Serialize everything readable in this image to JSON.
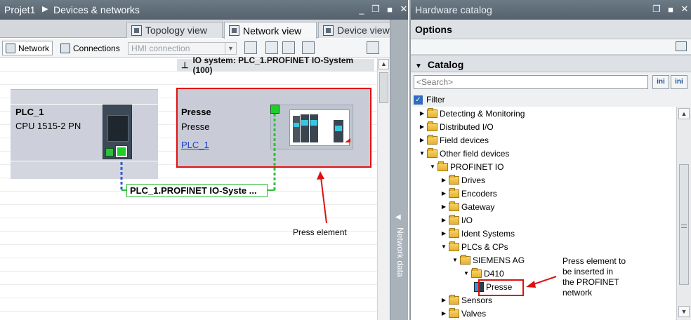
{
  "left_panel": {
    "breadcrumb": {
      "project": "Projet1",
      "separator": "▶",
      "page": "Devices & networks"
    },
    "window_buttons": [
      "_",
      "❐",
      "■",
      "✕"
    ],
    "tabs": [
      {
        "label": "Topology view",
        "active": false
      },
      {
        "label": "Network view",
        "active": true
      },
      {
        "label": "Device view",
        "active": false
      }
    ],
    "toolbar": {
      "network_label": "Network",
      "connections_label": "Connections",
      "connection_type": "HMI connection"
    },
    "io_system_label": "IO system: PLC_1.PROFINET IO-System (100)",
    "pin_icon": "⊥",
    "devices": {
      "plc": {
        "name": "PLC_1",
        "type": "CPU 1515-2 PN"
      },
      "presse": {
        "name": "Presse",
        "type": "Presse",
        "controller_link": "PLC_1"
      }
    },
    "network_label": "PLC_1.PROFINET  IO-Syste ...",
    "annotation": "Press element",
    "side_panel_label": "Network data",
    "side_panel_arrow": "◀"
  },
  "right_panel": {
    "title": "Hardware catalog",
    "options_label": "Options",
    "catalog_label": "Catalog",
    "search_placeholder": "<Search>",
    "search_buttons": [
      "ini",
      "ini"
    ],
    "filter_label": "Filter",
    "filter_checked": true,
    "tree": [
      {
        "label": "Detecting & Monitoring",
        "level": 0,
        "expanded": false
      },
      {
        "label": "Distributed I/O",
        "level": 0,
        "expanded": false
      },
      {
        "label": "Field devices",
        "level": 0,
        "expanded": false
      },
      {
        "label": "Other field devices",
        "level": 0,
        "expanded": true
      },
      {
        "label": "PROFINET IO",
        "level": 1,
        "expanded": true
      },
      {
        "label": "Drives",
        "level": 2,
        "expanded": false
      },
      {
        "label": "Encoders",
        "level": 2,
        "expanded": false
      },
      {
        "label": "Gateway",
        "level": 2,
        "expanded": false
      },
      {
        "label": "I/O",
        "level": 2,
        "expanded": false
      },
      {
        "label": "Ident Systems",
        "level": 2,
        "expanded": false
      },
      {
        "label": "PLCs & CPs",
        "level": 2,
        "expanded": true
      },
      {
        "label": "SIEMENS AG",
        "level": 3,
        "expanded": true
      },
      {
        "label": "D410",
        "level": 4,
        "expanded": true
      },
      {
        "label": "Presse",
        "level": 5,
        "device": true
      },
      {
        "label": "Sensors",
        "level": 2,
        "expanded": false
      },
      {
        "label": "Valves",
        "level": 2,
        "expanded": false
      }
    ],
    "annotation": "Press element to\nbe inserted in\nthe PROFINET\nnetwork"
  },
  "colors": {
    "title_bar": "#5f6d79",
    "highlight_red": "#e01010",
    "port_green": "#1ecf2a",
    "device_fill": "#c9ccd7",
    "link_blue": "#1a3fc8"
  }
}
